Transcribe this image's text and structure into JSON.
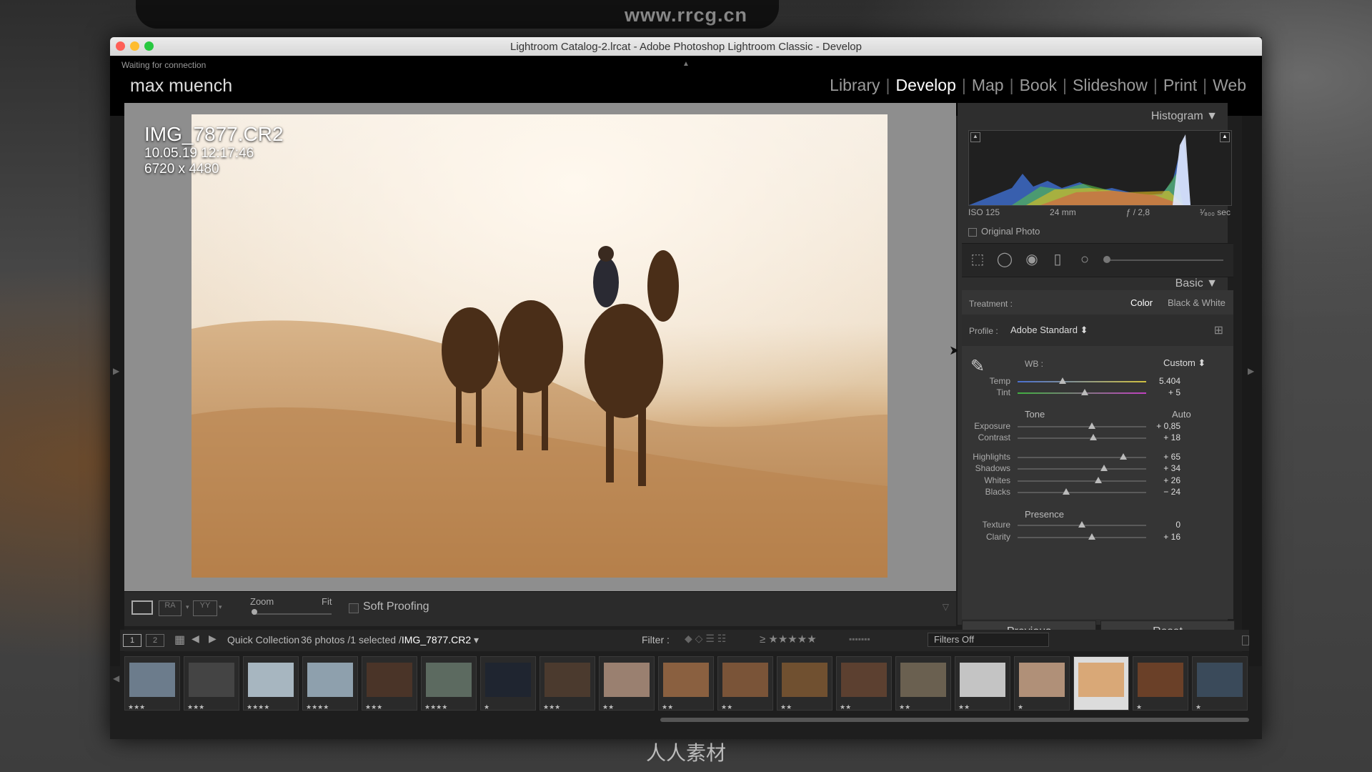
{
  "site_watermark": "www.rrcg.cn",
  "bottom_watermark": "人人素材",
  "window": {
    "title": "Lightroom Catalog-2.lrcat - Adobe Photoshop Lightroom Classic - Develop"
  },
  "header": {
    "status": "Waiting for connection",
    "identity_plate": "max muench",
    "modules": [
      "Library",
      "Develop",
      "Map",
      "Book",
      "Slideshow",
      "Print",
      "Web"
    ],
    "active_module": "Develop"
  },
  "photo_info": {
    "filename": "IMG_7877.CR2",
    "datetime": "10.05.19 12:17:46",
    "dimensions": "6720 x 4480"
  },
  "toolbar": {
    "zoom_label": "Zoom",
    "fit_label": "Fit",
    "soft_proofing": "Soft Proofing"
  },
  "histogram": {
    "title": "Histogram",
    "iso": "ISO 125",
    "focal": "24 mm",
    "aperture": "ƒ / 2,8",
    "shutter": "¹⁄₈₀₀ sec",
    "original_photo": "Original Photo"
  },
  "basic": {
    "title": "Basic",
    "treatment_label": "Treatment :",
    "treatment_color": "Color",
    "treatment_bw": "Black & White",
    "profile_label": "Profile :",
    "profile_value": "Adobe Standard",
    "wb_label": "WB :",
    "wb_value": "Custom",
    "tone_label": "Tone",
    "auto_label": "Auto",
    "presence_label": "Presence",
    "sliders": [
      {
        "label": "Temp",
        "value": "5.404",
        "pos": 0.35
      },
      {
        "label": "Tint",
        "value": "+ 5",
        "pos": 0.52
      },
      {
        "label": "Exposure",
        "value": "+ 0,85",
        "pos": 0.58
      },
      {
        "label": "Contrast",
        "value": "+ 18",
        "pos": 0.59
      },
      {
        "label": "Highlights",
        "value": "+ 65",
        "pos": 0.82
      },
      {
        "label": "Shadows",
        "value": "+ 34",
        "pos": 0.67
      },
      {
        "label": "Whites",
        "value": "+ 26",
        "pos": 0.63
      },
      {
        "label": "Blacks",
        "value": "− 24",
        "pos": 0.38
      },
      {
        "label": "Texture",
        "value": "0",
        "pos": 0.5
      },
      {
        "label": "Clarity",
        "value": "+ 16",
        "pos": 0.58
      }
    ]
  },
  "buttons": {
    "previous": "Previous",
    "reset": "Reset"
  },
  "filmbar": {
    "page1": "1",
    "page2": "2",
    "source": "Quick Collection",
    "count": "36 photos /1 selected /",
    "selected_file": "IMG_7877.CR2",
    "filter_label": "Filter :",
    "filters_off": "Filters Off"
  },
  "thumbnails": [
    {
      "stars": "★★★",
      "color": "#6c7c8c"
    },
    {
      "stars": "★★★",
      "color": "#444"
    },
    {
      "stars": "★★★★",
      "color": "#a7b6c0"
    },
    {
      "stars": "★★★★",
      "color": "#8ea0ad"
    },
    {
      "stars": "★★★",
      "color": "#4a3428"
    },
    {
      "stars": "★★★★",
      "color": "#5c6a60"
    },
    {
      "stars": "★",
      "color": "#1f2530"
    },
    {
      "stars": "★★★",
      "color": "#4b3a2e"
    },
    {
      "stars": "★★",
      "color": "#9a8070"
    },
    {
      "stars": "★★",
      "color": "#8a6040"
    },
    {
      "stars": "★★",
      "color": "#7a5438"
    },
    {
      "stars": "★★",
      "color": "#705030"
    },
    {
      "stars": "★★",
      "color": "#5c4030"
    },
    {
      "stars": "★★",
      "color": "#6a6050"
    },
    {
      "stars": "★★",
      "color": "#c4c4c4"
    },
    {
      "stars": "★",
      "color": "#b09078"
    },
    {
      "stars": "",
      "color": "#d9a877",
      "selected": true
    },
    {
      "stars": "★",
      "color": "#6a4028"
    },
    {
      "stars": "★",
      "color": "#3a4a5a"
    }
  ]
}
